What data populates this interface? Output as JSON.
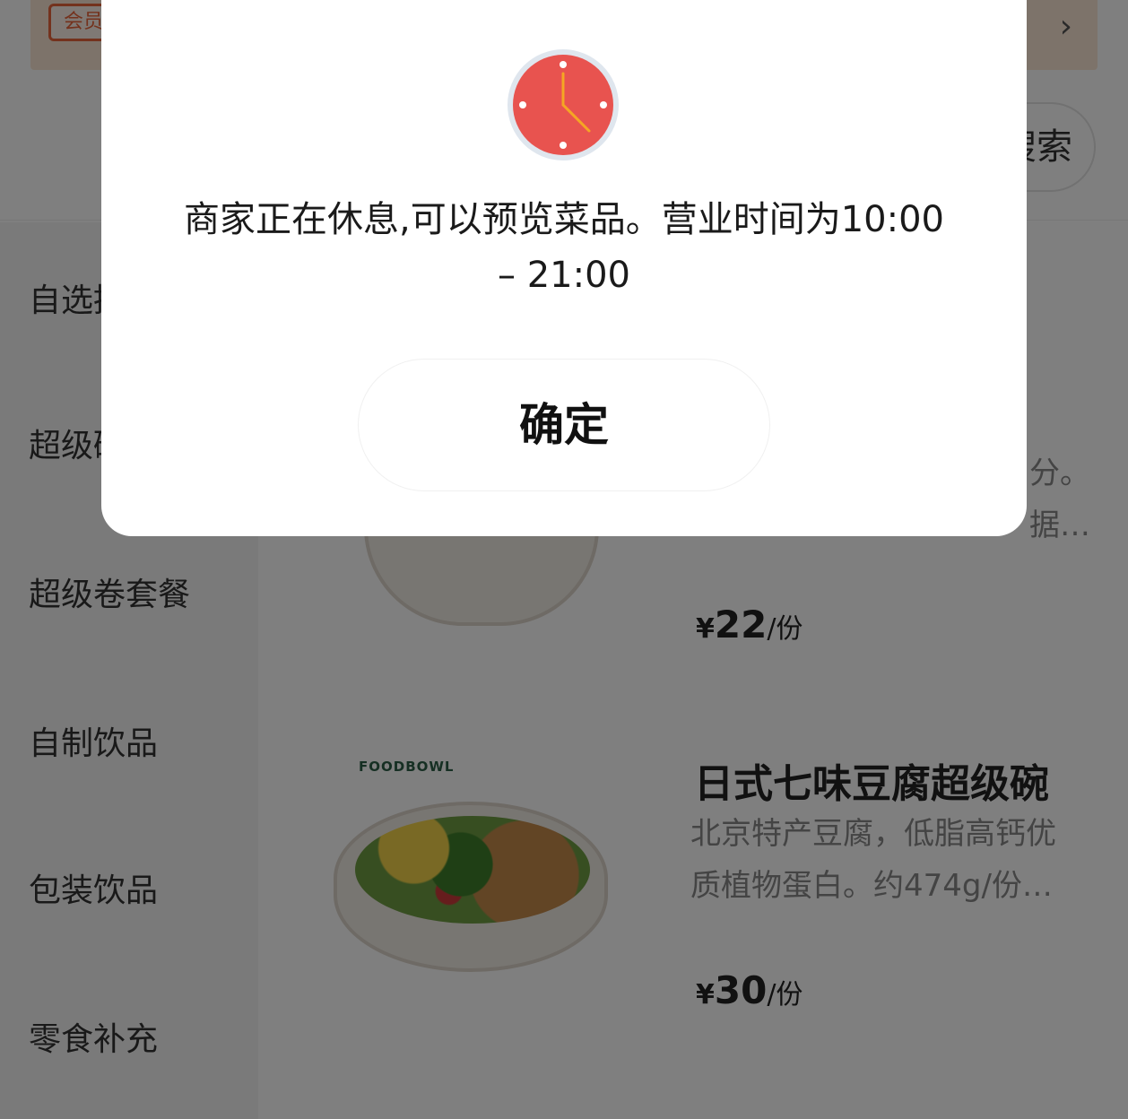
{
  "member_bar": {
    "badge_label": "会员"
  },
  "search": {
    "button_label": "搜索"
  },
  "sidebar": {
    "items": [
      {
        "label": "自选推荐"
      },
      {
        "label": "超级碗"
      },
      {
        "label": "超级卷套餐"
      },
      {
        "label": "自制饮品"
      },
      {
        "label": "包装饮品"
      },
      {
        "label": "零食补充"
      }
    ]
  },
  "products": [
    {
      "partial_desc_line1": "分。",
      "partial_desc_line2": "据…",
      "price": {
        "currency": "¥",
        "amount": "22",
        "unit": "/份"
      }
    },
    {
      "brand": "FOODBOWL",
      "title": "日式七味豆腐超级碗",
      "desc_line1": "北京特产豆腐，低脂高钙优",
      "desc_line2": "质植物蛋白。约474g/份…",
      "price": {
        "currency": "¥",
        "amount": "30",
        "unit": "/份"
      }
    }
  ],
  "modal": {
    "icon": "clock-icon",
    "message_line1": "商家正在休息,可以预览菜品。营业时间为10:00",
    "message_line2": "– 21:00",
    "confirm_label": "确定"
  },
  "colors": {
    "accent": "#e8653a",
    "clock_face": "#e8534f",
    "clock_hands": "#f5a623",
    "overlay": "rgba(0,0,0,0.5)"
  }
}
